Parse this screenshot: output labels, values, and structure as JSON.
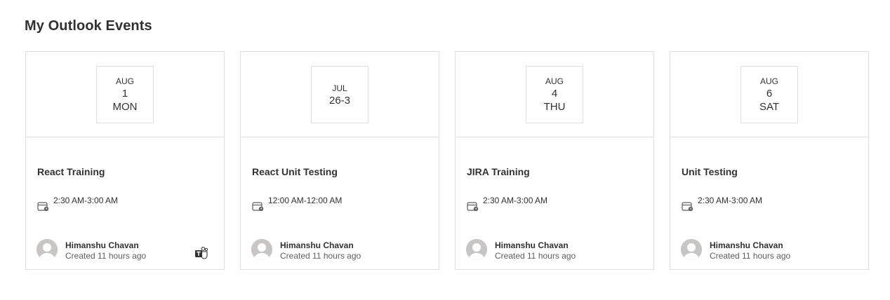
{
  "page": {
    "title": "My Outlook Events"
  },
  "events": [
    {
      "month": "AUG",
      "day": "1",
      "weekday": "MON",
      "title": "React Training",
      "time": "2:30 AM-3:00 AM",
      "author": "Himanshu Chavan",
      "created": "Created 11 hours ago",
      "teams_icon": "teams-icon"
    },
    {
      "month": "JUL",
      "day": "26-3",
      "weekday": "",
      "title": "React Unit Testing",
      "time": "12:00 AM-12:00 AM",
      "author": "Himanshu Chavan",
      "created": "Created 11 hours ago"
    },
    {
      "month": "AUG",
      "day": "4",
      "weekday": "THU",
      "title": "JIRA Training",
      "time": "2:30 AM-3:00 AM",
      "author": "Himanshu Chavan",
      "created": "Created 11 hours ago"
    },
    {
      "month": "AUG",
      "day": "6",
      "weekday": "SAT",
      "title": "Unit Testing",
      "time": "2:30 AM-3:00 AM",
      "author": "Himanshu Chavan",
      "created": "Created 11 hours ago"
    }
  ],
  "colors": {
    "border": "#e1dfdd",
    "text": "#323130",
    "secondary_text": "#605e5c",
    "avatar_bg": "#c8c6c4"
  }
}
